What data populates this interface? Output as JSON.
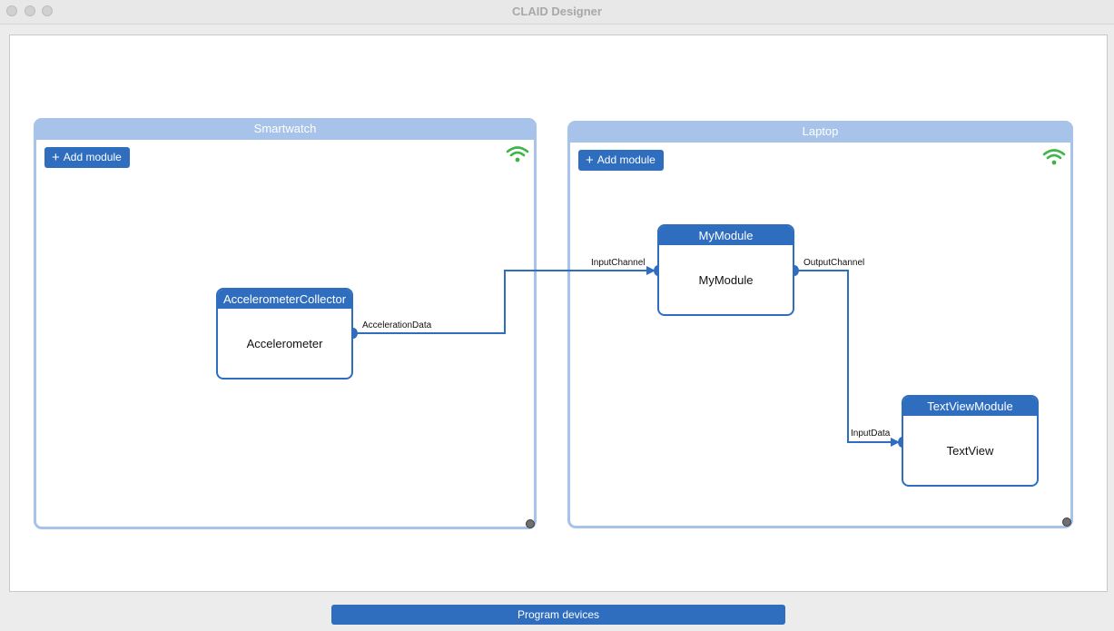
{
  "window": {
    "title": "CLAID Designer"
  },
  "devices": [
    {
      "name": "Smartwatch",
      "add_label": "Add module"
    },
    {
      "name": "Laptop",
      "add_label": "Add module"
    }
  ],
  "modules": {
    "accelerometer": {
      "title": "AccelerometerCollector",
      "body": "Accelerometer",
      "output": "AccelerationData"
    },
    "mymodule": {
      "title": "MyModule",
      "body": "MyModule",
      "input": "InputChannel",
      "output": "OutputChannel"
    },
    "textview": {
      "title": "TextViewModule",
      "body": "TextView",
      "input": "InputData"
    }
  },
  "footer": {
    "program_label": "Program devices"
  },
  "colors": {
    "accent": "#2f6dbf",
    "device": "#a7c3ea",
    "wifi": "#3fb549"
  },
  "icons": {
    "plus": "+",
    "wifi": "wifi-icon",
    "resize": "resize-handle"
  }
}
